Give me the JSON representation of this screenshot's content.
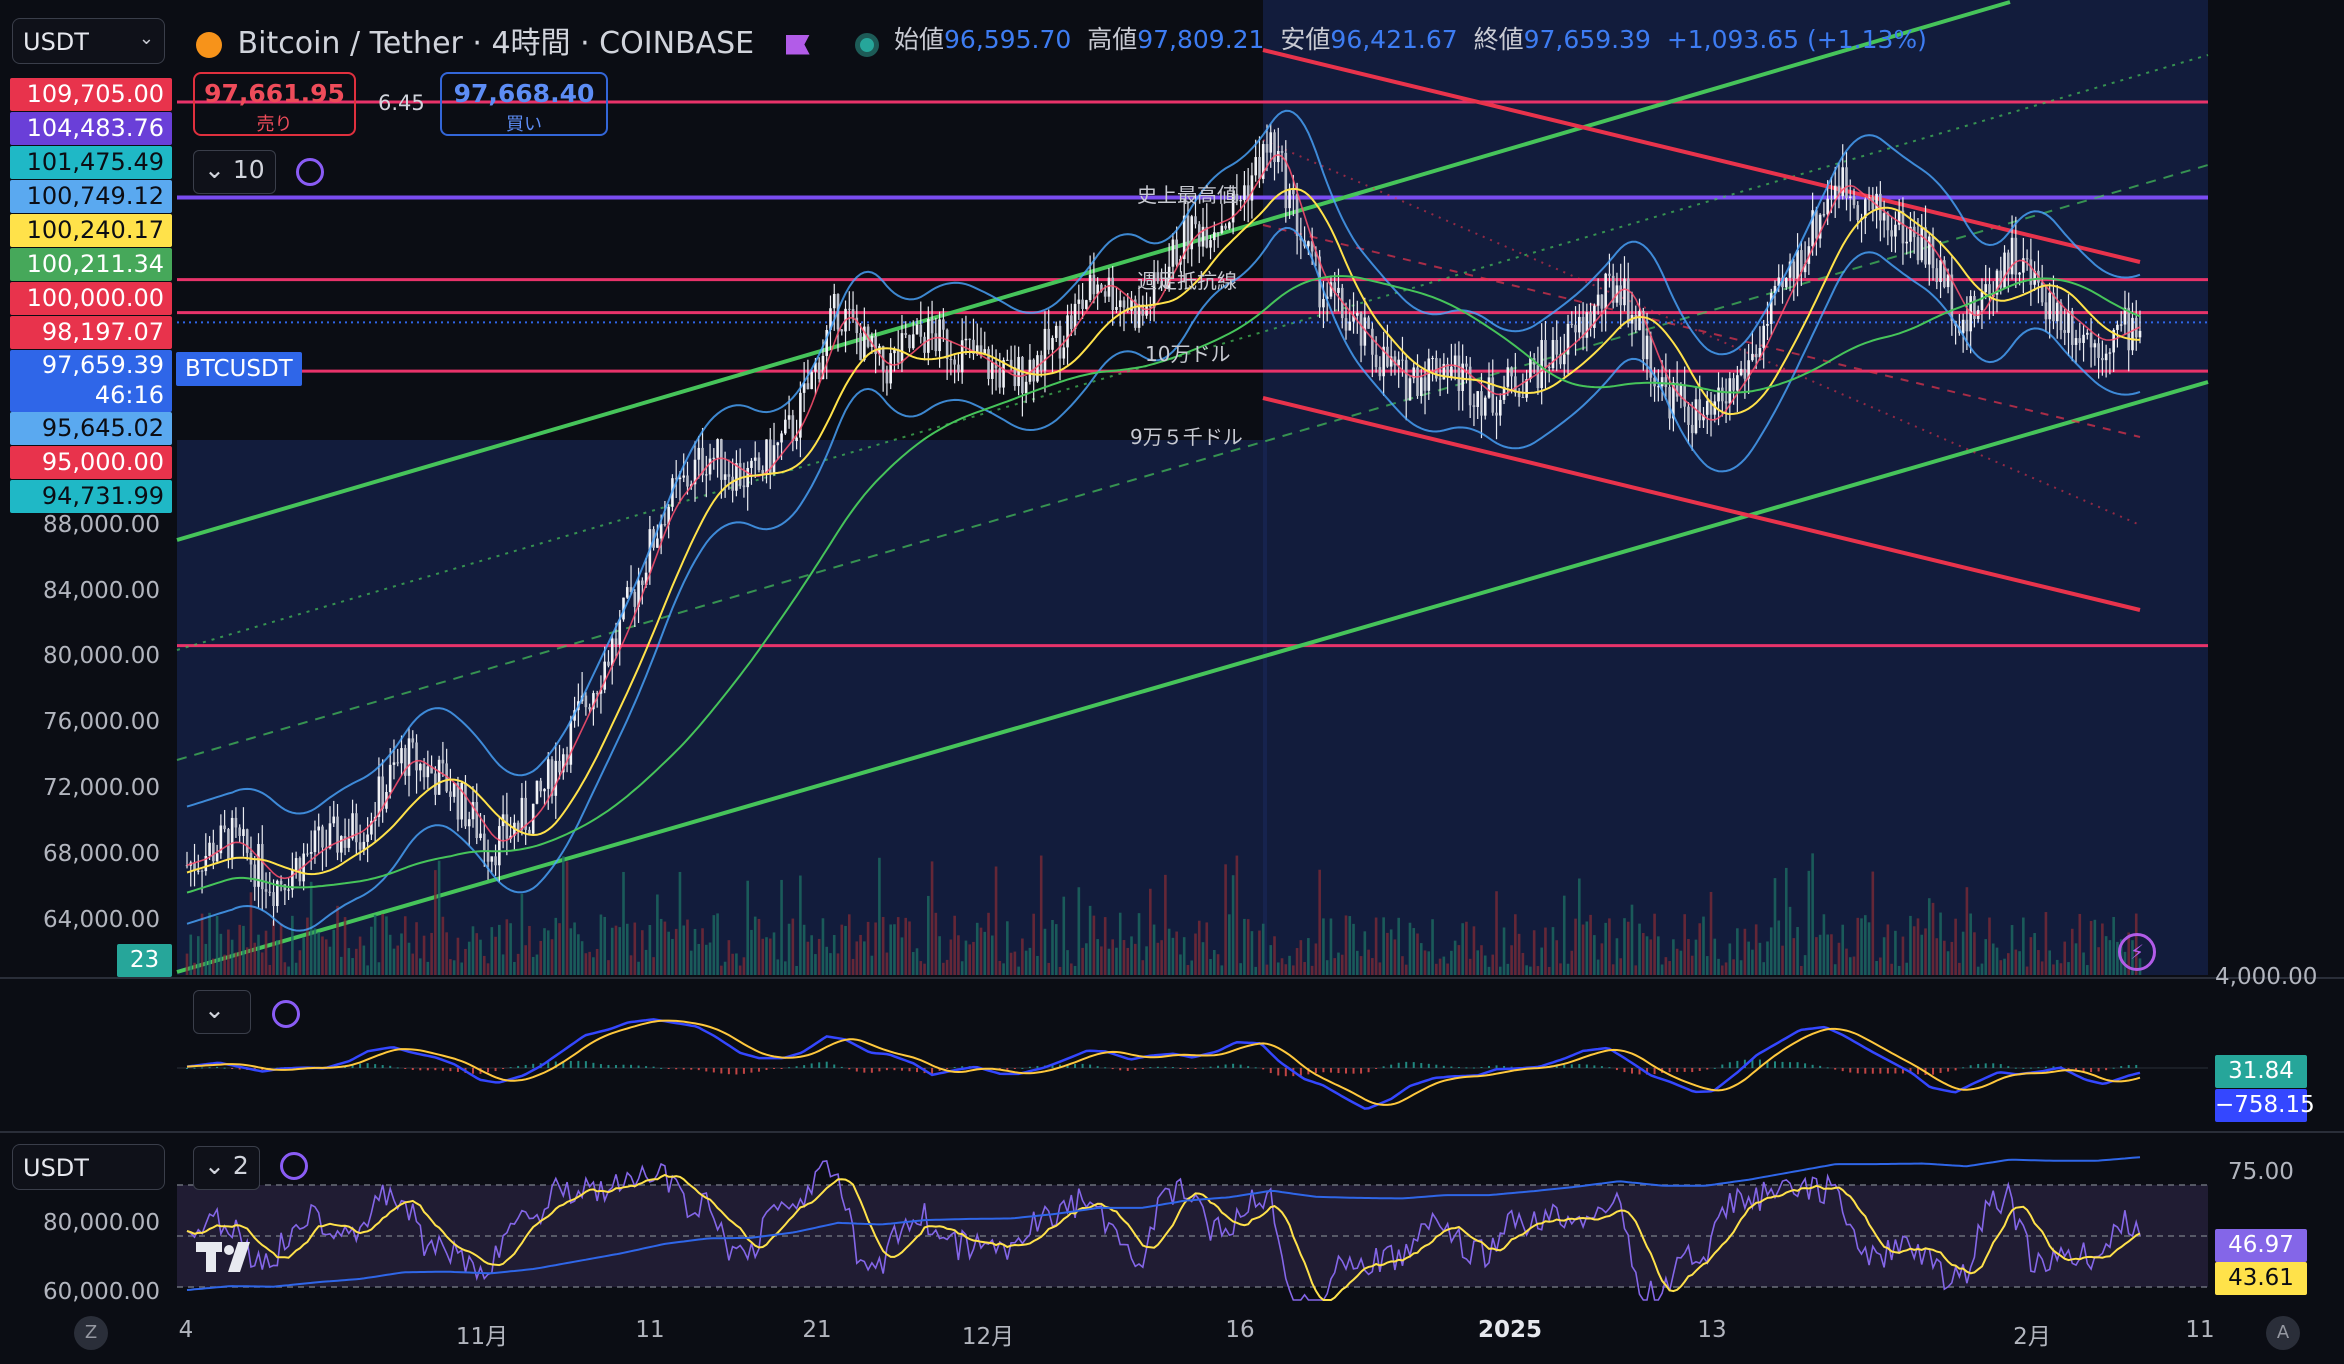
{
  "colors": {
    "background": "#0b0d14",
    "up": "#e8eaf0",
    "down": "#e8eaf0",
    "sma_fast": "#ff4f6d",
    "sma_mid": "#ffe24a",
    "sma_slow": "#46c45a",
    "bollinger": "#4aa6ff",
    "channel_up": "#46c45a",
    "channel_down": "#e8334c",
    "level_line": "#e8336a",
    "purple_line": "#7a4cf0",
    "macd_line": "#3447ff",
    "signal_line": "#ffc83d",
    "rsi_line": "#8466e8",
    "rsi_ma": "#ffe24a",
    "rsi_band": "#2a2440"
  },
  "header": {
    "currency_select": "USDT",
    "title": "Bitcoin / Tether · 4時間 · COINBASE",
    "coin_icon": "bitcoin-icon",
    "ohlc": {
      "open_label": "始値",
      "open": "96,595.70",
      "high_label": "高値",
      "high": "97,809.21",
      "low_label": "安値",
      "low": "96,421.67",
      "close_label": "終値",
      "close": "97,659.39",
      "change": "+1,093.65 (+1.13%)"
    }
  },
  "trade": {
    "sell_price": "97,661.95",
    "sell_label": "売り",
    "spread": "6.45",
    "buy_price": "97,668.40",
    "buy_label": "買い"
  },
  "indicator_buttons": {
    "main": "10",
    "macd": "",
    "rsi": "2"
  },
  "price_tags": [
    {
      "value": "109,705.00",
      "bg": "#e8334c",
      "fg": "#ffffff"
    },
    {
      "value": "104,483.76",
      "bg": "#6a3fd8",
      "fg": "#ffffff"
    },
    {
      "value": "101,475.49",
      "bg": "#1fb8c6",
      "fg": "#0b0d14"
    },
    {
      "value": "100,749.12",
      "bg": "#5aa9f0",
      "fg": "#0b0d14"
    },
    {
      "value": "100,240.17",
      "bg": "#ffe24a",
      "fg": "#0b0d14"
    },
    {
      "value": "100,211.34",
      "bg": "#46a85a",
      "fg": "#ffffff"
    },
    {
      "value": "100,000.00",
      "bg": "#e8334c",
      "fg": "#ffffff"
    },
    {
      "value": "98,197.07",
      "bg": "#e8334c",
      "fg": "#ffffff"
    },
    {
      "value": "97,659.39",
      "bg": "#2f66e8",
      "fg": "#ffffff",
      "sub": "46:16"
    },
    {
      "value": "95,645.02",
      "bg": "#5aa9f0",
      "fg": "#0b0d14"
    },
    {
      "value": "95,000.00",
      "bg": "#e8334c",
      "fg": "#ffffff"
    },
    {
      "value": "94,731.99",
      "bg": "#1fb8c6",
      "fg": "#0b0d14"
    }
  ],
  "symbol_tag": "BTCUSDT",
  "volume_tag": "23",
  "y_axis": [
    "88,000.00",
    "84,000.00",
    "80,000.00",
    "76,000.00",
    "72,000.00",
    "68,000.00",
    "64,000.00"
  ],
  "macd_axis": "4,000.00",
  "macd_values": {
    "hist": "31.84",
    "macd": "−758.15"
  },
  "rsi_axis": [
    "75.00",
    "80,000.00",
    "60,000.00"
  ],
  "rsi_values": {
    "rsi": "46.97",
    "ma": "43.61"
  },
  "rsi_select": "USDT",
  "x_axis": [
    "4",
    "11月",
    "11",
    "21",
    "12月",
    "16",
    "2025",
    "13",
    "2月",
    "11"
  ],
  "annotations": {
    "ath": "史上最高値",
    "weekly": "週足抵抗線",
    "ten_man": "10万ドル",
    "nine_five": "9万５千ドル"
  },
  "chart_data": {
    "type": "line",
    "title": "Bitcoin / Tether · 4時間 · COINBASE",
    "xlabel": "",
    "ylabel": "",
    "x": [
      "4",
      "11月",
      "11",
      "21",
      "12月",
      "16",
      "2025",
      "13",
      "2月",
      "11"
    ],
    "ylim": [
      62000,
      112000
    ],
    "series": [
      {
        "values": [
          68000,
          69500,
          67000,
          69000,
          70000,
          74000,
          72500,
          69000,
          71000,
          76000,
          81000,
          87500,
          90500,
          89000,
          92000,
          98500,
          95000,
          97000,
          96000,
          94500,
          96500,
          100000,
          98000,
          102500,
          103500,
          107500,
          100000,
          97000,
          94500,
          95500,
          93500,
          95000,
          97000,
          100000,
          94000,
          92000,
          95500,
          100500,
          105500,
          103500,
          102000,
          97500,
          101500,
          98500,
          96500,
          97659
        ]
      }
    ],
    "levels": [
      109705,
      104483.76,
      100000,
      98197.07,
      95000,
      80000
    ],
    "last": 97659.39
  }
}
